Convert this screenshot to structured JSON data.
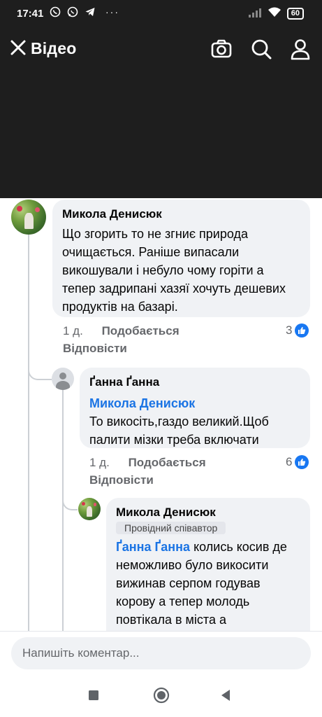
{
  "status_bar": {
    "time": "17:41",
    "dots": "···",
    "battery": "60"
  },
  "header": {
    "title": "Відео"
  },
  "comments": [
    {
      "author": "Микола Денисюк",
      "text": "Що згорить то не згниє природа очищається. Раніше випасали викошували і небуло чому горіти а тепер задрипані хазяї хочуть дешевих продуктів на базарі.",
      "time": "1 д.",
      "like_label": "Подобається",
      "reply_label": "Відповісти",
      "reaction_count": "3"
    },
    {
      "author": "Ґанна Ґанна",
      "mention": "Микола Денисюк",
      "text": "То викосіть,газдо великий.Щоб палити мізки треба включати",
      "time": "1 д.",
      "like_label": "Подобається",
      "reply_label": "Відповісти",
      "reaction_count": "6"
    },
    {
      "author": "Микола Денисюк",
      "badge": "Провідний співавтор",
      "mention": "Ґанна Ґанна",
      "text": " колись косив де неможливо було викосити вижинав серпом годував корову а тепер молодь повтікала в міста а"
    }
  ],
  "compose": {
    "placeholder": "Напишіть коментар..."
  }
}
